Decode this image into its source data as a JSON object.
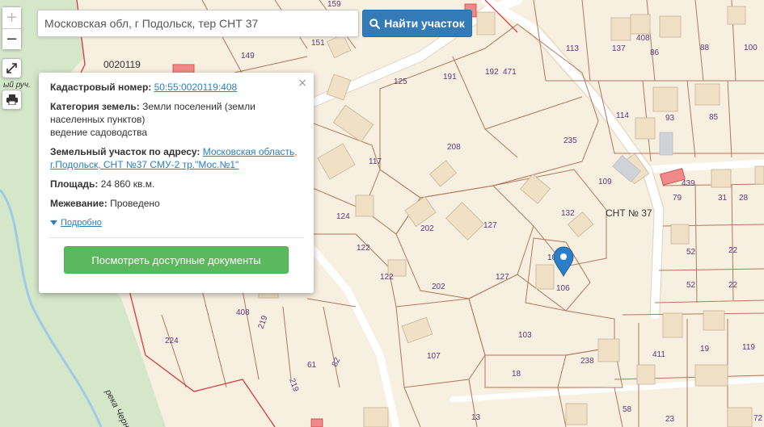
{
  "search": {
    "value": "Московская обл, г Подольск, тер СНТ 37",
    "button_label": "Найти участок"
  },
  "controls": {
    "zoom_in": "+",
    "zoom_out": "−"
  },
  "popup": {
    "cadastral_label": "Кадастровый номер:",
    "cadastral_value": "50:55:0020119:408",
    "category_label": "Категория земель:",
    "category_value": "Земли поселений (земли населенных пунктов)",
    "category_use": "ведение садоводства",
    "address_label": "Земельный участок по адресу:",
    "address_value": "Московская область, г.Подольск, СНТ №37 СМУ-2 тр.\"Мос.№1\"",
    "area_label": "Площадь:",
    "area_value": "24 860 кв.м.",
    "survey_label": "Межевание:",
    "survey_value": "Проведено",
    "more_label": "Подробно",
    "docs_button": "Посмотреть доступные документы",
    "close": "×"
  },
  "map_labels": {
    "quarter": "0020119",
    "snt": "СНТ № 37",
    "river": "река Черн",
    "stream": "ый руч."
  },
  "plots": [
    "149",
    "151",
    "159",
    "125",
    "191",
    "192",
    "471",
    "113",
    "137",
    "408",
    "86",
    "88",
    "100",
    "117",
    "208",
    "235",
    "114",
    "93",
    "85",
    "124",
    "202",
    "127",
    "132",
    "109",
    "439",
    "79",
    "31",
    "28",
    "122",
    "122",
    "202",
    "127",
    "106",
    "106",
    "52",
    "22",
    "52",
    "22",
    "408",
    "219",
    "219",
    "61",
    "82",
    "224",
    "107",
    "103",
    "18",
    "238",
    "411",
    "19",
    "119",
    "13",
    "58",
    "23",
    "72"
  ],
  "colors": {
    "map_background": "#f7efdf",
    "forest": "#d5e7c9",
    "road": "#ffffff",
    "boundary_red": "#d93a3a",
    "boundary_brown": "#b4765a",
    "building": "#efe0c6",
    "marker": "#2a7fc8",
    "search_button": "#337ab7",
    "docs_button": "#5cb85c"
  }
}
